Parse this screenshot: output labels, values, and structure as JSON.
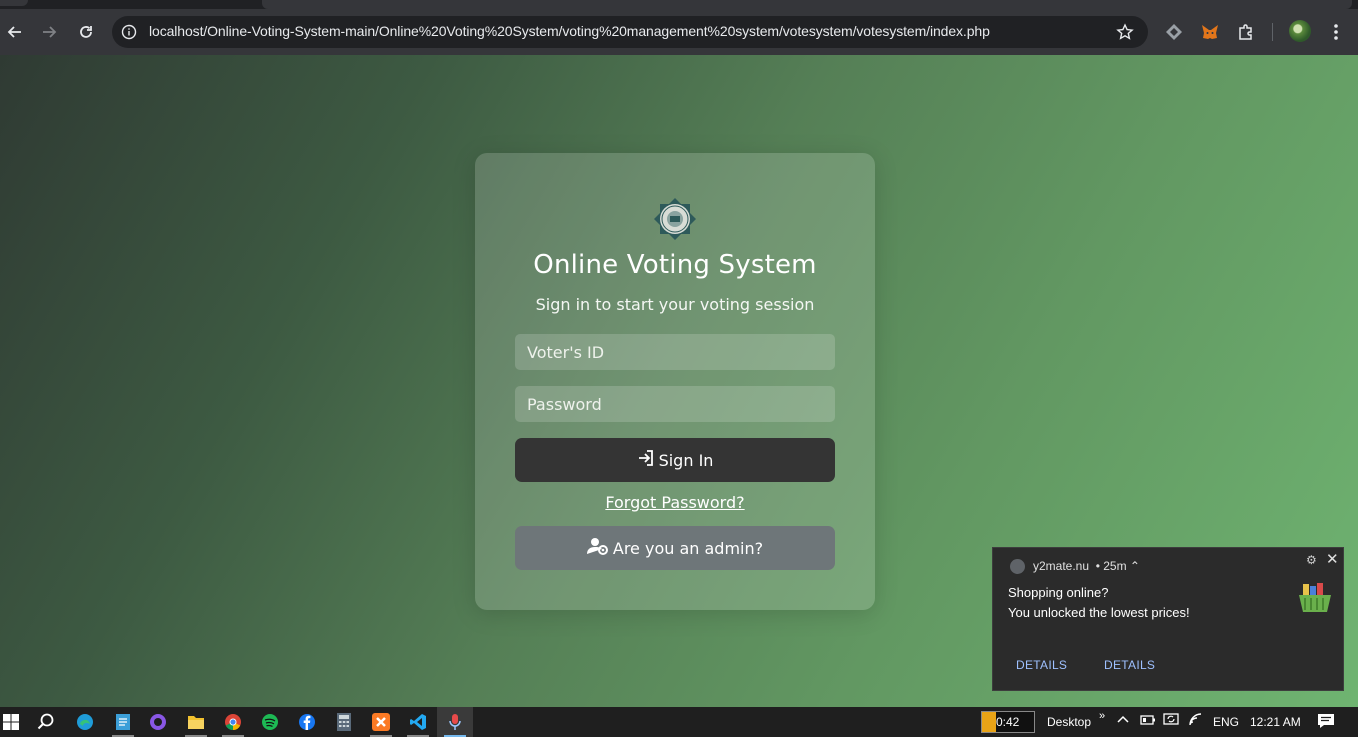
{
  "browser": {
    "url": "localhost/Online-Voting-System-main/Online%20Voting%20System/voting%20management%20system/votesystem/votesystem/index.php",
    "icons": [
      "back-icon",
      "forward-icon",
      "reload-icon",
      "site-info-icon",
      "bookmark-star-icon",
      "extension-diamond-icon",
      "metamask-fox-icon",
      "extensions-puzzle-icon",
      "profile-avatar",
      "menu-kebab-icon"
    ]
  },
  "login": {
    "title": "Online Voting System",
    "subtitle": "Sign in to start your voting session",
    "voter_placeholder": "Voter's ID",
    "voter_value": "",
    "password_placeholder": "Password",
    "password_value": "",
    "signin_label": "Sign In",
    "forgot_label": "Forgot Password?",
    "admin_label": "Are you an admin?"
  },
  "notification": {
    "source": "y2mate.nu",
    "age": "25m",
    "title": "Shopping online?",
    "body": "You unlocked the lowest prices!",
    "actions": [
      "DETAILS",
      "DETAILS"
    ]
  },
  "taskbar": {
    "apps": [
      "start-icon",
      "search-icon",
      "edge-icon",
      "notepad-icon",
      "github-desktop-icon",
      "file-explorer-icon",
      "chrome-icon",
      "spotify-icon",
      "facebook-icon",
      "calculator-icon",
      "xampp-icon",
      "vscode-icon",
      "voice-recorder-icon"
    ],
    "timer": "0:42",
    "desktop_label": "Desktop",
    "language": "ENG",
    "time": "12:21 AM"
  },
  "colors": {
    "page_gradient_start": "#2f3a33",
    "page_gradient_end": "#6fb471",
    "signin_button": "#343434",
    "admin_button": "#6e7679",
    "notification_link": "#9ec0ff"
  }
}
